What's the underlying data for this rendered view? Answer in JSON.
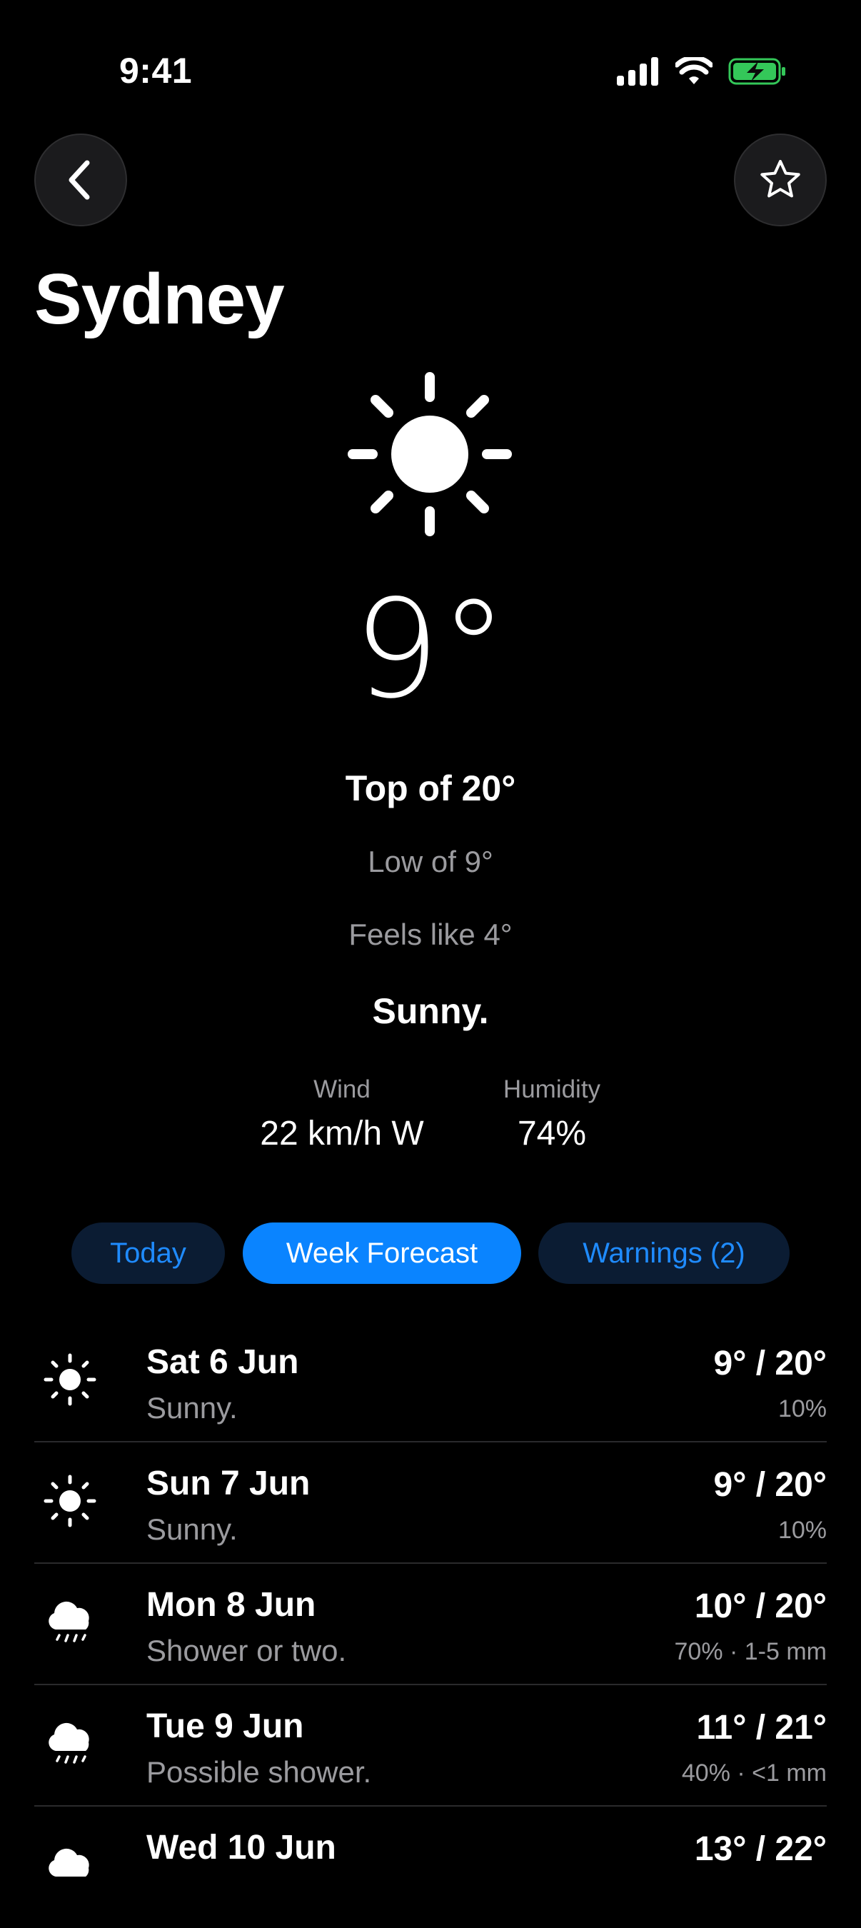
{
  "status": {
    "time": "9:41"
  },
  "city": "Sydney",
  "current": {
    "temperature": "9°",
    "top": "Top of 20°",
    "low": "Low of 9°",
    "feels_like": "Feels like 4°",
    "condition": "Sunny.",
    "wind_label": "Wind",
    "wind_value": "22 km/h W",
    "humidity_label": "Humidity",
    "humidity_value": "74%"
  },
  "tabs": {
    "today": "Today",
    "week": "Week Forecast",
    "warnings": "Warnings (2)",
    "active": "week"
  },
  "forecast": [
    {
      "day": "Sat 6 Jun",
      "desc": "Sunny.",
      "range": "9° / 20°",
      "rain": "10%",
      "icon": "sun-icon"
    },
    {
      "day": "Sun 7 Jun",
      "desc": "Sunny.",
      "range": "9° / 20°",
      "rain": "10%",
      "icon": "sun-icon"
    },
    {
      "day": "Mon 8 Jun",
      "desc": "Shower or two.",
      "range": "10° / 20°",
      "rain": "70% · 1-5 mm",
      "icon": "rain-cloud-icon"
    },
    {
      "day": "Tue 9 Jun",
      "desc": "Possible shower.",
      "range": "11° / 21°",
      "rain": "40% · <1 mm",
      "icon": "rain-cloud-icon"
    },
    {
      "day": "Wed 10 Jun",
      "desc": "",
      "range": "13° / 22°",
      "rain": "",
      "icon": "cloud-icon"
    }
  ],
  "colors": {
    "accent": "#0a84ff",
    "battery": "#34c759",
    "muted": "#9b9b9f"
  }
}
